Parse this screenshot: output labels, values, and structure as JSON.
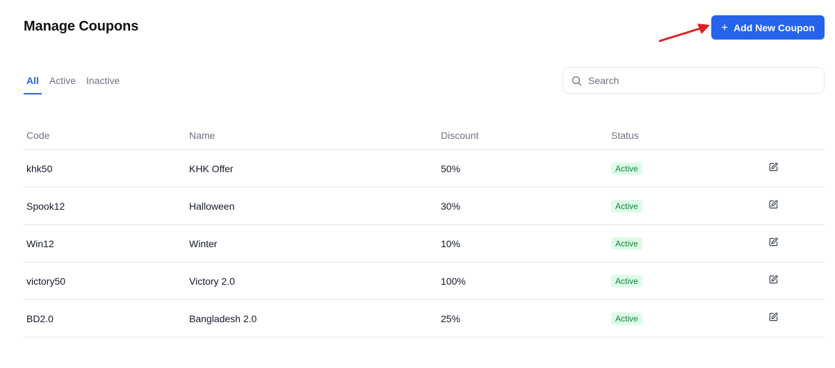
{
  "header": {
    "title": "Manage Coupons",
    "add_button_label": "Add New Coupon",
    "add_button_icon": "plus-icon"
  },
  "tabs": [
    {
      "label": "All",
      "active": true
    },
    {
      "label": "Active",
      "active": false
    },
    {
      "label": "Inactive",
      "active": false
    }
  ],
  "search": {
    "placeholder": "Search",
    "value": ""
  },
  "table": {
    "columns": [
      "Code",
      "Name",
      "Discount",
      "Status"
    ],
    "rows": [
      {
        "code": "khk50",
        "name": "KHK Offer",
        "discount": "50%",
        "status": "Active"
      },
      {
        "code": "Spook12",
        "name": "Halloween",
        "discount": "30%",
        "status": "Active"
      },
      {
        "code": "Win12",
        "name": "Winter",
        "discount": "10%",
        "status": "Active"
      },
      {
        "code": "victory50",
        "name": "Victory 2.0",
        "discount": "100%",
        "status": "Active"
      },
      {
        "code": "BD2.0",
        "name": "Bangladesh 2.0",
        "discount": "25%",
        "status": "Active"
      }
    ]
  },
  "colors": {
    "accent": "#2563eb",
    "status_active_bg": "#dcfce7",
    "status_active_text": "#15803d",
    "annotation_arrow": "#e11d1d"
  }
}
